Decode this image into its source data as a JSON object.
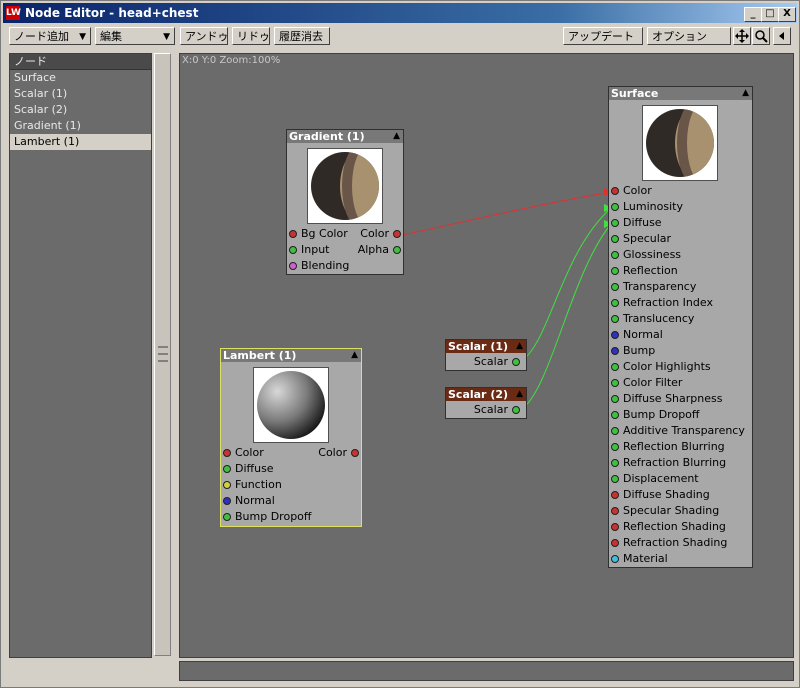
{
  "window": {
    "title": "Node Editor - head+chest",
    "app_icon": "LW"
  },
  "window_buttons": {
    "minimize": "_",
    "maximize": "□",
    "close": "X"
  },
  "toolbar": {
    "add_node": "ノード追加",
    "edit": "編集",
    "undo": "アンドゥ",
    "redo": "リドゥ",
    "clear_history": "履歴消去",
    "update": "アップデート",
    "options": "オプション"
  },
  "node_list": {
    "header": "ノード",
    "items": [
      "Surface",
      "Scalar (1)",
      "Scalar (2)",
      "Gradient (1)",
      "Lambert (1)"
    ],
    "selected": 4
  },
  "canvas": {
    "info": "X:0 Y:0 Zoom:100%"
  },
  "gradient": {
    "title": "Gradient (1)",
    "inputs": [
      "Bg Color",
      "Input",
      "Blending"
    ],
    "outputs": [
      "Color",
      "Alpha"
    ]
  },
  "lambert": {
    "title": "Lambert (1)",
    "inputs": [
      "Color",
      "Diffuse",
      "Function",
      "Normal",
      "Bump Dropoff"
    ],
    "outputs": [
      "Color"
    ]
  },
  "scalar1": {
    "title": "Scalar (1)",
    "output": "Scalar"
  },
  "scalar2": {
    "title": "Scalar (2)",
    "output": "Scalar"
  },
  "surface": {
    "title": "Surface",
    "inputs": [
      "Color",
      "Luminosity",
      "Diffuse",
      "Specular",
      "Glossiness",
      "Reflection",
      "Transparency",
      "Refraction Index",
      "Translucency",
      "Normal",
      "Bump",
      "Color Highlights",
      "Color Filter",
      "Diffuse Sharpness",
      "Bump Dropoff",
      "Additive Transparency",
      "Reflection Blurring",
      "Refraction Blurring",
      "Displacement",
      "Diffuse Shading",
      "Specular Shading",
      "Reflection Shading",
      "Refraction Shading",
      "Material"
    ]
  },
  "port_colors": {
    "color": "#c83232",
    "scalar": "#40c040",
    "integer": "#d0d040",
    "vector": "#3030c0",
    "function": "#d060d0",
    "material": "#40c0e0"
  }
}
